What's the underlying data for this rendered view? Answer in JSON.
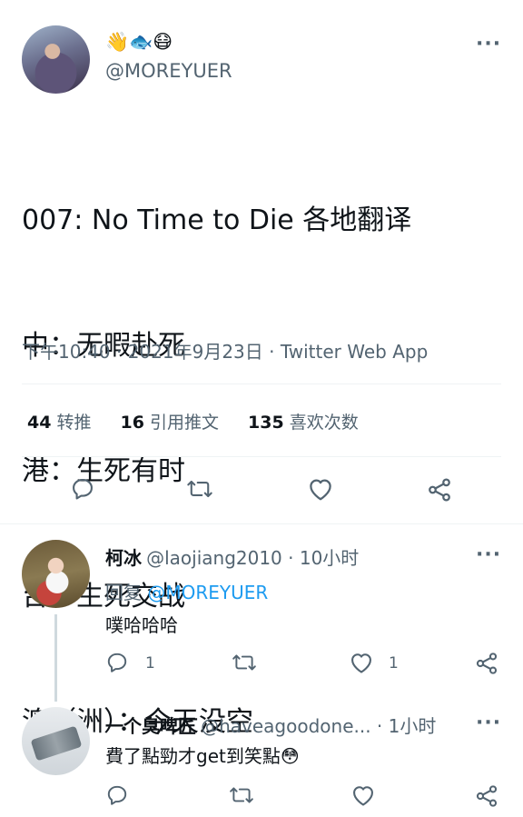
{
  "tweet": {
    "emoji_name": "👋🐟😷",
    "handle": "@MOREYUER",
    "text_lines": [
      "007: No Time to Die 各地翻译",
      "中：无暇赴死",
      "港：生死有时",
      "台：生死交战",
      "澳（洲）：今天没空"
    ],
    "meta": "下午10:40 · 2021年9月23日 · Twitter Web App",
    "stats": {
      "retweets_count": "44",
      "retweets_label": "转推",
      "quotes_count": "16",
      "quotes_label": "引用推文",
      "likes_count": "135",
      "likes_label": "喜欢次数"
    },
    "more_label": "···"
  },
  "replies": [
    {
      "name": "柯冰",
      "handle": "@laojiang2010 · 10小时",
      "reply_prefix": "回复",
      "reply_mention": "@MOREYUER",
      "text": "噗哈哈哈",
      "reply_count": "1",
      "like_count": "1",
      "more_label": "···"
    },
    {
      "name": "一个臭啤匠",
      "handle": "@haveagoodone... · 1小时",
      "text": "費了點勁才get到笑點😳",
      "more_label": "···"
    }
  ],
  "icons": {
    "reply": "reply-icon",
    "retweet": "retweet-icon",
    "like": "heart-icon",
    "share": "share-icon",
    "more": "more-icon"
  },
  "colors": {
    "text": "#0f1419",
    "secondary": "#536471",
    "link": "#1d9bf0",
    "divider": "#eff3f4"
  }
}
